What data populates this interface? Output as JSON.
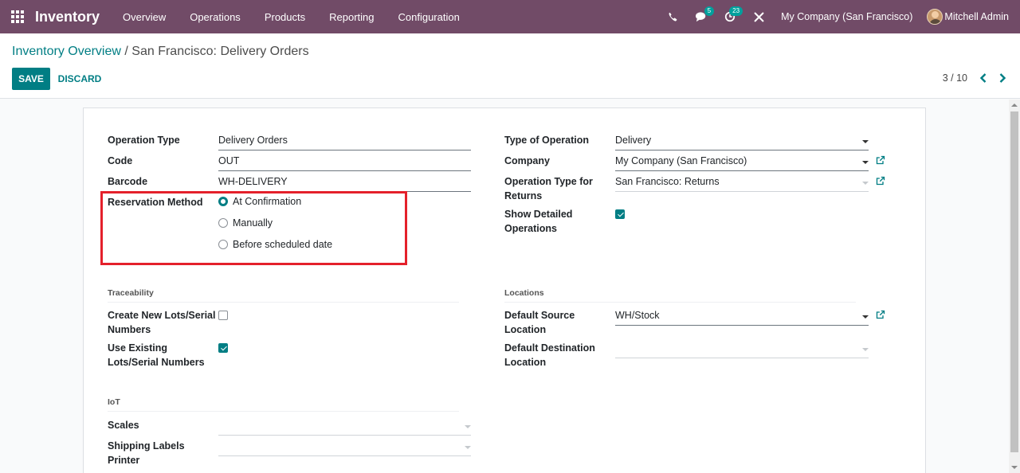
{
  "navbar": {
    "app_title": "Inventory",
    "menu": [
      "Overview",
      "Operations",
      "Products",
      "Reporting",
      "Configuration"
    ],
    "messages_badge": "5",
    "activities_badge": "23",
    "company": "My Company (San Francisco)",
    "user": "Mitchell Admin",
    "bg_color": "#714b67"
  },
  "control": {
    "breadcrumb_parent": "Inventory Overview",
    "breadcrumb_sep": " / ",
    "breadcrumb_current": "San Francisco: Delivery Orders",
    "save_label": "SAVE",
    "discard_label": "DISCARD",
    "pager": "3 / 10",
    "accent_color": "#017e84"
  },
  "form": {
    "left": {
      "operation_type_label": "Operation Type",
      "operation_type_value": "Delivery Orders",
      "code_label": "Code",
      "code_value": "OUT",
      "barcode_label": "Barcode",
      "barcode_value": "WH-DELIVERY",
      "reservation_label": "Reservation Method",
      "reservation_options": [
        "At Confirmation",
        "Manually",
        "Before scheduled date"
      ],
      "reservation_selected": "At Confirmation"
    },
    "right": {
      "type_of_operation_label": "Type of Operation",
      "type_of_operation_value": "Delivery",
      "company_label": "Company",
      "company_value": "My Company (San Francisco)",
      "return_type_label_1": "Operation Type for",
      "return_type_label_2": "Returns",
      "return_type_value": "San Francisco: Returns",
      "show_detailed_label_1": "Show Detailed",
      "show_detailed_label_2": "Operations",
      "show_detailed_checked": true
    },
    "traceability": {
      "title": "Traceability",
      "create_lots_label_1": "Create New Lots/Serial",
      "create_lots_label_2": "Numbers",
      "create_lots_checked": false,
      "use_existing_label_1": "Use Existing",
      "use_existing_label_2": "Lots/Serial Numbers",
      "use_existing_checked": true
    },
    "locations": {
      "title": "Locations",
      "source_label_1": "Default Source",
      "source_label_2": "Location",
      "source_value": "WH/Stock",
      "dest_label_1": "Default Destination",
      "dest_label_2": "Location",
      "dest_value": ""
    },
    "iot": {
      "title": "IoT",
      "scales_label": "Scales",
      "scales_value": "",
      "printer_label_1": "Shipping Labels",
      "printer_label_2": "Printer",
      "printer_value": ""
    }
  }
}
